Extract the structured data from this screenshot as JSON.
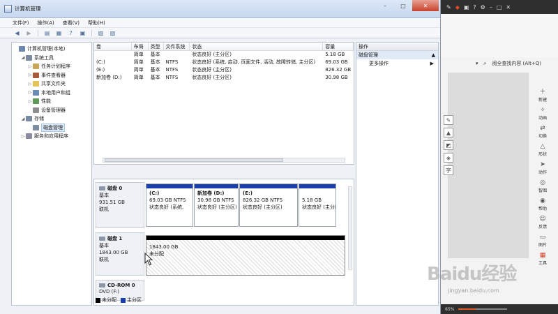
{
  "window": {
    "title": "计算机管理"
  },
  "window_buttons": {
    "minimize": "–",
    "maximize": "□",
    "close": "✕"
  },
  "menu": [
    "文件(F)",
    "操作(A)",
    "查看(V)",
    "帮助(H)"
  ],
  "toolbar_icons": [
    "back-icon",
    "forward-icon",
    "console-tree-icon",
    "properties-icon",
    "help-icon",
    "refresh-icon",
    "export-icon",
    "settings-icon"
  ],
  "tree": [
    {
      "label": "计算机管理(本地)",
      "level": 0,
      "expander": "",
      "icon": "computer-icon",
      "color": "#6d87ad"
    },
    {
      "label": "系统工具",
      "level": 1,
      "expander": "◢",
      "icon": "tools-icon",
      "color": "#7a8aa0"
    },
    {
      "label": "任务计划程序",
      "level": 2,
      "expander": "▷",
      "icon": "clock-icon",
      "color": "#c9a45a"
    },
    {
      "label": "事件查看器",
      "level": 2,
      "expander": "▷",
      "icon": "event-icon",
      "color": "#a75b3a"
    },
    {
      "label": "共享文件夹",
      "level": 2,
      "expander": "▷",
      "icon": "folder-icon",
      "color": "#e3c25e"
    },
    {
      "label": "本地用户和组",
      "level": 2,
      "expander": "▷",
      "icon": "users-icon",
      "color": "#6a8ab8"
    },
    {
      "label": "性能",
      "level": 2,
      "expander": "▷",
      "icon": "performance-icon",
      "color": "#5f9a5a"
    },
    {
      "label": "设备管理器",
      "level": 2,
      "expander": "",
      "icon": "device-icon",
      "color": "#8e8e8e"
    },
    {
      "label": "存储",
      "level": 1,
      "expander": "◢",
      "icon": "storage-icon",
      "color": "#7a8aa0"
    },
    {
      "label": "磁盘管理",
      "level": 2,
      "expander": "",
      "icon": "disk-icon",
      "color": "#7d8ea3",
      "selected": true
    },
    {
      "label": "服务和应用程序",
      "level": 1,
      "expander": "▷",
      "icon": "services-icon",
      "color": "#8a8aa0"
    }
  ],
  "volumes": {
    "headers": [
      "卷",
      "布局",
      "类型",
      "文件系统",
      "状态",
      "容量"
    ],
    "rows": [
      [
        "",
        "简单",
        "基本",
        "",
        "状态良好 (主分区)",
        "5.18 GB"
      ],
      [
        "(C:)",
        "简单",
        "基本",
        "NTFS",
        "状态良好 (系统, 启动, 页面文件, 活动, 故障转储, 主分区)",
        "69.03 GB"
      ],
      [
        "(E:)",
        "简单",
        "基本",
        "NTFS",
        "状态良好 (主分区)",
        "826.32 GB"
      ],
      [
        "新加卷 (D:)",
        "简单",
        "基本",
        "NTFS",
        "状态良好 (主分区)",
        "30.98 GB"
      ]
    ]
  },
  "disks": [
    {
      "name": "磁盘 0",
      "type": "基本",
      "size": "931.51 GB",
      "status": "联机",
      "partitions": [
        {
          "title": "(C:)",
          "detail": "69.03 GB NTFS",
          "status": "状态良好 (系统,"
        },
        {
          "title": "新加卷 (D:)",
          "detail": "30.98 GB NTFS",
          "status": "状态良好 (主分区)"
        },
        {
          "title": "(E:)",
          "detail": "826.32 GB NTFS",
          "status": "状态良好 (主分区)"
        },
        {
          "title": "",
          "detail": "5.18 GB",
          "status": "状态良好 (主分区"
        }
      ]
    },
    {
      "name": "磁盘 1",
      "type": "基本",
      "size": "1843.00 GB",
      "status": "联机",
      "unallocated": {
        "size": "1843.00 GB",
        "label": "未分配"
      }
    },
    {
      "name": "CD-ROM 0",
      "type": "DVD (F:)"
    }
  ],
  "legend": [
    {
      "label": "未分配",
      "color": "#000000"
    },
    {
      "label": "主分区",
      "color": "#1b3fa8"
    }
  ],
  "actions": {
    "header": "操作",
    "section": "磁盘管理",
    "items": [
      {
        "label": "更多操作",
        "arrow": "▶"
      }
    ],
    "section_arrow": "▲"
  },
  "right_app": {
    "search_hint": "阅全查找内容 (Alt+Q)",
    "tools": [
      {
        "label": "新建",
        "icon": "new-icon"
      },
      {
        "label": "动画",
        "icon": "animation-icon"
      },
      {
        "label": "切换",
        "icon": "transition-icon"
      },
      {
        "label": "形状",
        "icon": "shape-icon"
      },
      {
        "label": "动作",
        "icon": "action-icon"
      },
      {
        "label": "智图",
        "icon": "smart-image-icon"
      },
      {
        "label": "帮助",
        "icon": "help-icon"
      },
      {
        "label": "反馈",
        "icon": "feedback-icon"
      },
      {
        "label": "图片",
        "icon": "picture-icon"
      },
      {
        "label": "工具",
        "icon": "toolbox-icon"
      }
    ],
    "zoom": "65%",
    "zoom_fraction": 0.35,
    "watermark": "Baidu经验",
    "watermark_url": "jingyan.baidu.com"
  }
}
